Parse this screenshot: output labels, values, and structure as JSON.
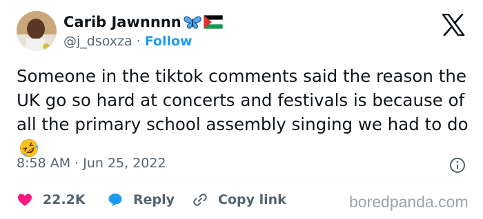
{
  "author": {
    "display_name": "Carib Jawnnnn",
    "name_icons": [
      "butterfly-emoji",
      "palestine-flag-emoji"
    ],
    "handle": "@j_dsoxza",
    "separator": "·",
    "follow_label": "Follow"
  },
  "tweet": {
    "text": "Someone in the tiktok comments said the reason the UK go so hard at concerts and festivals is because of all the primary school assembly singing we had to do",
    "trailing_emoji": "rolling-on-floor-laughing-emoji",
    "timestamp": "8:58 AM · Jun 25, 2022"
  },
  "actions": {
    "likes_count": "22.2K",
    "reply_label": "Reply",
    "copy_link_label": "Copy link"
  },
  "watermark": "boredpanda.com",
  "colors": {
    "text": "#0f1419",
    "secondary": "#536471",
    "link": "#1d9bf0",
    "like": "#f91880",
    "reply": "#1d9bf0"
  }
}
